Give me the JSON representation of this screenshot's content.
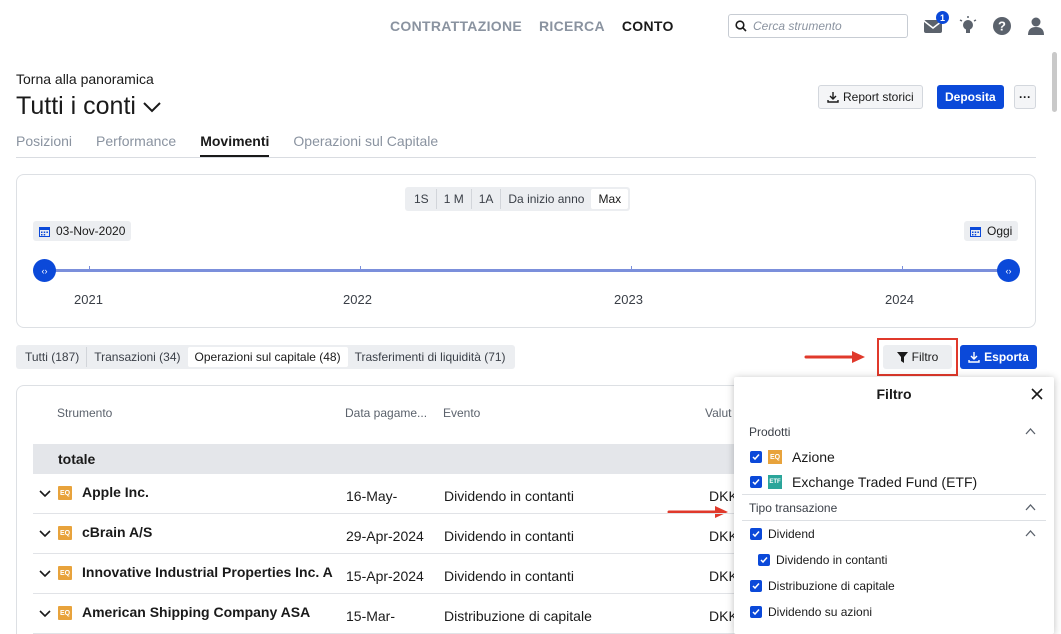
{
  "nav": {
    "items": [
      {
        "label": "CONTRATTAZIONE",
        "active": false
      },
      {
        "label": "RICERCA",
        "active": false
      },
      {
        "label": "CONTO",
        "active": true
      }
    ]
  },
  "search": {
    "placeholder": "Cerca strumento"
  },
  "notifications": {
    "count": "1"
  },
  "header": {
    "back_link": "Torna alla panoramica",
    "title": "Tutti i conti",
    "report_label": "Report storici",
    "deposit_label": "Deposita",
    "more_label": "···"
  },
  "tabs": [
    {
      "label": "Posizioni",
      "active": false
    },
    {
      "label": "Performance",
      "active": false
    },
    {
      "label": "Movimenti",
      "active": true
    },
    {
      "label": "Operazioni sul Capitale",
      "active": false
    }
  ],
  "timeline": {
    "ranges": [
      {
        "label": "1S",
        "active": false
      },
      {
        "label": "1 M",
        "active": false
      },
      {
        "label": "1A",
        "active": false
      },
      {
        "label": "Da inizio anno",
        "active": false
      },
      {
        "label": "Max",
        "active": true
      }
    ],
    "start_date": "03-Nov-2020",
    "end_date": "Oggi",
    "years": [
      "2021",
      "2022",
      "2023",
      "2024"
    ]
  },
  "segments": [
    {
      "label": "Tutti (187)",
      "active": false
    },
    {
      "label": "Transazioni (34)",
      "active": false
    },
    {
      "label": "Operazioni sul capitale (48)",
      "active": true
    },
    {
      "label": "Trasferimenti di liquidità (71)",
      "active": false
    }
  ],
  "actions": {
    "filter_label": "Filtro",
    "export_label": "Esporta"
  },
  "table": {
    "headers": {
      "instrument": "Strumento",
      "payment_date": "Data pagame...",
      "event": "Evento",
      "currency": "Valut"
    },
    "total_label": "totale",
    "rows": [
      {
        "type": "EQ",
        "name": "Apple Inc.",
        "date": "16-May-",
        "event": "Dividendo in contanti",
        "currency": "DKK"
      },
      {
        "type": "EQ",
        "name": "cBrain A/S",
        "date": "29-Apr-2024",
        "event": "Dividendo in contanti",
        "currency": "DKK"
      },
      {
        "type": "EQ",
        "name": "Innovative Industrial Properties Inc. A",
        "date": "15-Apr-2024",
        "event": "Dividendo in contanti",
        "currency": "DKK"
      },
      {
        "type": "EQ",
        "name": "American Shipping Company ASA",
        "date": "15-Mar-",
        "event": "Distribuzione di capitale",
        "currency": "DKK"
      }
    ]
  },
  "filter_panel": {
    "title": "Filtro",
    "products_label": "Prodotti",
    "products": [
      {
        "badge": "EQ",
        "label": "Azione"
      },
      {
        "badge": "ETF",
        "label": "Exchange Traded Fund (ETF)"
      }
    ],
    "transaction_type_label": "Tipo transazione",
    "types": {
      "dividend": "Dividend",
      "cash_dividend": "Dividendo in contanti",
      "capital_distribution": "Distribuzione di capitale",
      "stock_dividend": "Dividendo su azioni"
    }
  },
  "colors": {
    "accent": "#0b49d9",
    "highlight": "#e0392b",
    "eq_badge": "#e8a33c",
    "etf_badge": "#2aa59a"
  }
}
